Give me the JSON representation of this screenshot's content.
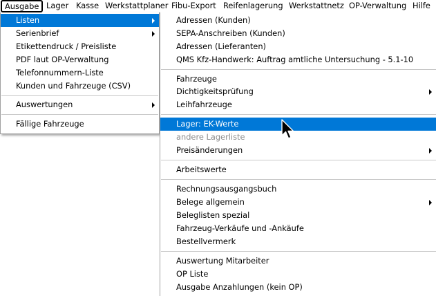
{
  "menubar": {
    "items": [
      {
        "label": "Ausgabe"
      },
      {
        "label": "Lager"
      },
      {
        "label": "Kasse"
      },
      {
        "label": "Werkstattplaner"
      },
      {
        "label": "Fibu-Export"
      },
      {
        "label": "Reifenlagerung"
      },
      {
        "label": "Werkstattnetz"
      },
      {
        "label": "OP-Verwaltung"
      },
      {
        "label": "Hilfe"
      }
    ]
  },
  "main_menu": {
    "items": [
      {
        "label": "Listen"
      },
      {
        "label": "Serienbrief"
      },
      {
        "label": "Etikettendruck / Preisliste"
      },
      {
        "label": "PDF laut OP-Verwaltung"
      },
      {
        "label": "Telefonnummern-Liste"
      },
      {
        "label": "Kunden und Fahrzeuge (CSV)"
      },
      {
        "label": "Auswertungen"
      },
      {
        "label": "Fällige Fahrzeuge"
      }
    ]
  },
  "sub_menu": {
    "items": [
      {
        "label": "Adressen (Kunden)"
      },
      {
        "label": "SEPA-Anschreiben (Kunden)"
      },
      {
        "label": "Adressen (Lieferanten)"
      },
      {
        "label": "QMS Kfz-Handwerk: Auftrag amtliche Untersuchung - 5.1-10"
      },
      {
        "label": "Fahrzeuge"
      },
      {
        "label": "Dichtigkeitsprüfung"
      },
      {
        "label": "Leihfahrzeuge"
      },
      {
        "label": "Lager: EK-Werte"
      },
      {
        "label": "andere Lagerliste"
      },
      {
        "label": "Preisänderungen"
      },
      {
        "label": "Arbeitswerte"
      },
      {
        "label": "Rechnungsausgangsbuch"
      },
      {
        "label": "Belege allgemein"
      },
      {
        "label": "Beleglisten spezial"
      },
      {
        "label": "Fahrzeug-Verkäufe und -Ankäufe"
      },
      {
        "label": "Bestellvermerk"
      },
      {
        "label": "Auswertung Mitarbeiter"
      },
      {
        "label": "OP Liste"
      },
      {
        "label": "Ausgabe Anzahlungen (kein OP)"
      }
    ]
  },
  "colors": {
    "highlight": "#0078d7",
    "disabled_text": "#8c8c8c",
    "separator": "#c8c8c8"
  }
}
